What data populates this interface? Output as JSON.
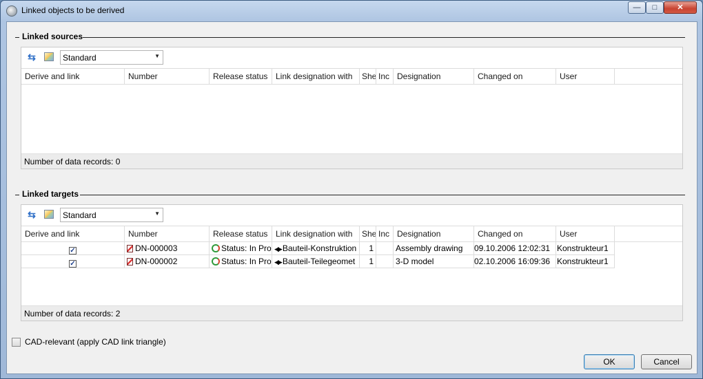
{
  "window": {
    "title": "Linked objects to be derived",
    "min_glyph": "—",
    "max_glyph": "□",
    "close_glyph": "✕"
  },
  "sources": {
    "group_label": "Linked sources",
    "layout_select": "Standard",
    "columns": [
      "Derive and link",
      "Number",
      "Release status",
      "Link designation with",
      "She",
      "Inc",
      "Designation",
      "Changed on",
      "User"
    ],
    "footer": "Number of data records: 0"
  },
  "targets": {
    "group_label": "Linked targets",
    "layout_select": "Standard",
    "columns": [
      "Derive and link",
      "Number",
      "Release status",
      "Link designation with",
      "She",
      "Inc",
      "Designation",
      "Changed on",
      "User"
    ],
    "rows": [
      {
        "derive": true,
        "number": "DN-000003",
        "status": "Status: In Prog",
        "link": "Bauteil-Konstruktion",
        "sheet": "1",
        "inc": "",
        "designation": "Assembly drawing",
        "changed": "09.10.2006 12:02:31",
        "user": "Konstrukteur1"
      },
      {
        "derive": true,
        "number": "DN-000002",
        "status": "Status: In Prog",
        "link": "Bauteil-Teilegeomet",
        "sheet": "1",
        "inc": "",
        "designation": "3-D model",
        "changed": "02.10.2006 16:09:36",
        "user": "Konstrukteur1"
      }
    ],
    "footer": "Number of data records: 2"
  },
  "cad_checkbox": {
    "label": "CAD-relevant (apply CAD link triangle)",
    "checked": false
  },
  "buttons": {
    "ok": "OK",
    "cancel": "Cancel"
  },
  "icons": {
    "refresh": "refresh-icon",
    "layout": "layout-icon",
    "dropdown": "chevron-down-icon",
    "document": "document-icon",
    "status": "status-cycle-icon",
    "link": "link-direction-icon",
    "checkmark": "✓",
    "arrow_down": "▼",
    "refresh_glyph": "⇆",
    "link_glyph": "◀▶"
  }
}
